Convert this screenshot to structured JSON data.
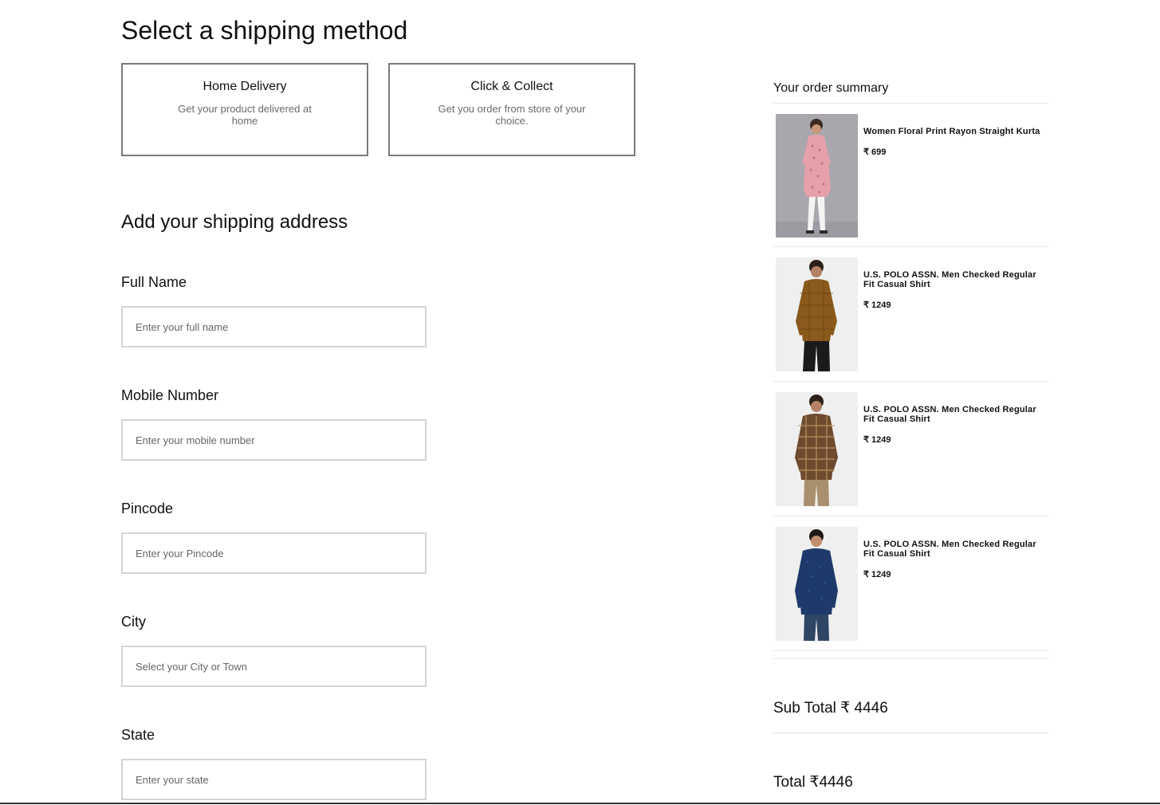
{
  "shipping": {
    "heading": "Select a shipping method",
    "methods": [
      {
        "title": "Home Delivery",
        "description": "Get your product delivered at home"
      },
      {
        "title": "Click & Collect",
        "description": "Get you order from store of your choice."
      }
    ]
  },
  "address": {
    "heading": "Add your shipping address",
    "fields": [
      {
        "label": "Full Name",
        "placeholder": "Enter your full name"
      },
      {
        "label": "Mobile Number",
        "placeholder": "Enter your mobile number"
      },
      {
        "label": "Pincode",
        "placeholder": "Enter your Pincode"
      },
      {
        "label": "City",
        "placeholder": "Select your City or Town"
      },
      {
        "label": "State",
        "placeholder": "Enter your state"
      }
    ]
  },
  "summary": {
    "title": "Your order summary",
    "items": [
      {
        "name": "Women Floral Print Rayon Straight Kurta",
        "price": "₹ 699"
      },
      {
        "name": "U.S. POLO ASSN. Men Checked Regular Fit Casual Shirt",
        "price": "₹ 1249"
      },
      {
        "name": "U.S. POLO ASSN. Men Checked Regular Fit Casual Shirt",
        "price": "₹ 1249"
      },
      {
        "name": "U.S. POLO ASSN. Men Checked Regular Fit Casual Shirt",
        "price": "₹ 1249"
      }
    ],
    "subtotal": "Sub Total ₹ 4446",
    "total": "Total ₹4446"
  }
}
